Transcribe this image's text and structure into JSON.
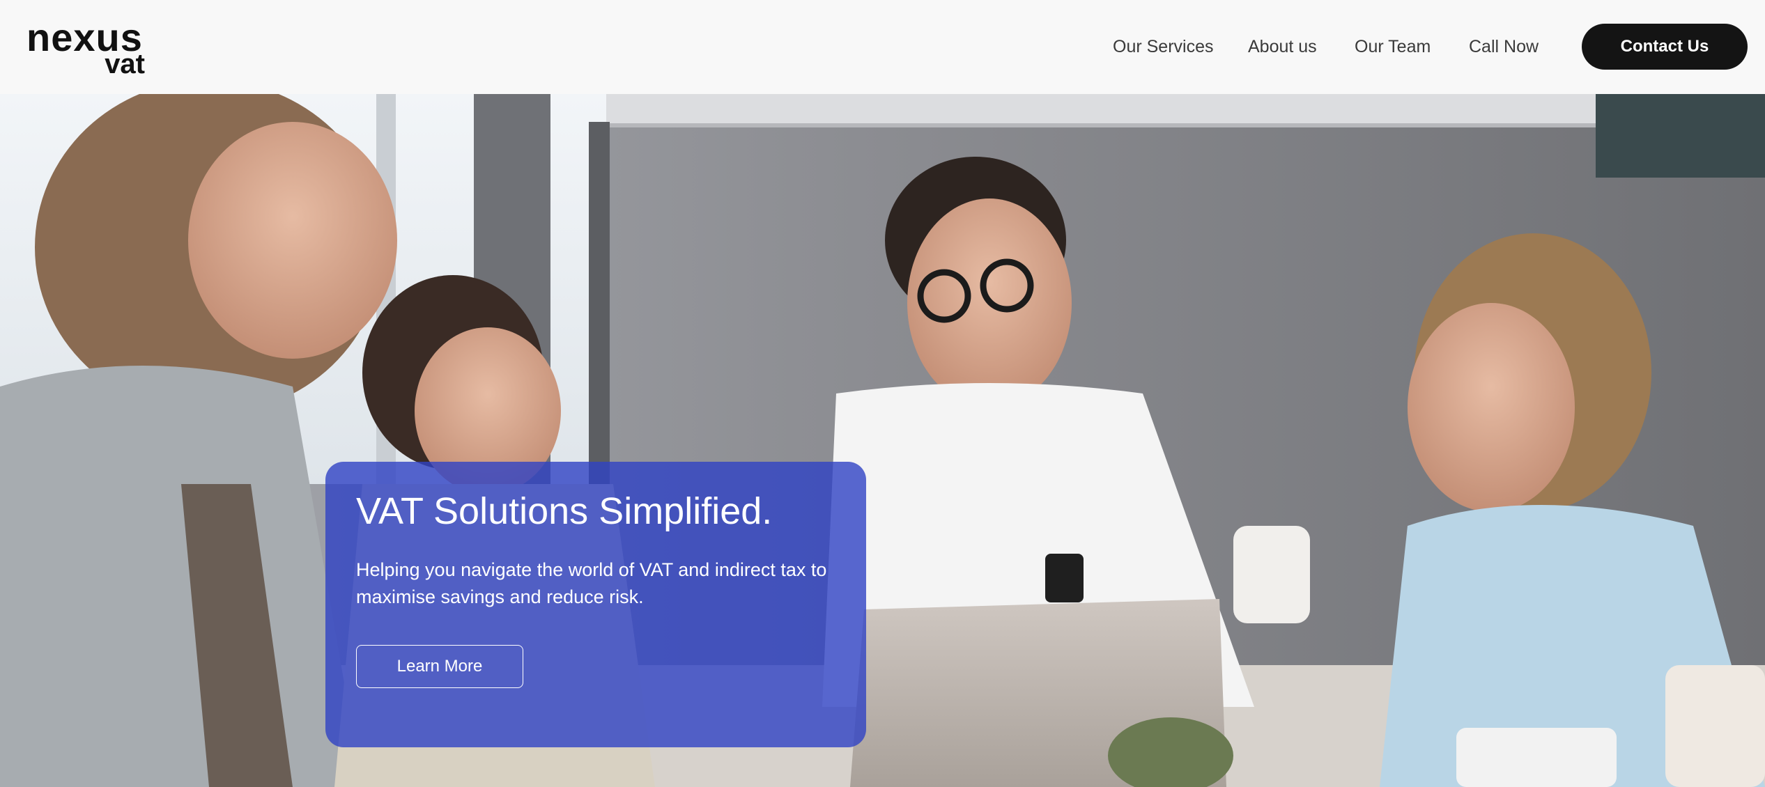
{
  "logo": {
    "line1": "nexus",
    "line2": "vat"
  },
  "nav": {
    "items": [
      {
        "label": "Our Services"
      },
      {
        "label": "About us"
      },
      {
        "label": "Our Team"
      },
      {
        "label": "Call Now"
      }
    ],
    "cta_label": "Contact Us"
  },
  "hero": {
    "title": "VAT Solutions Simplified.",
    "description": "Helping you navigate the world of VAT and indirect tax to maximise savings and reduce risk.",
    "button_label": "Learn More",
    "card_color": "#3042c4",
    "photo": "office team meeting photo"
  },
  "colors": {
    "header_bg": "#f8f8f8",
    "cta_bg": "#141414",
    "text_dark": "#1a1a1a"
  }
}
